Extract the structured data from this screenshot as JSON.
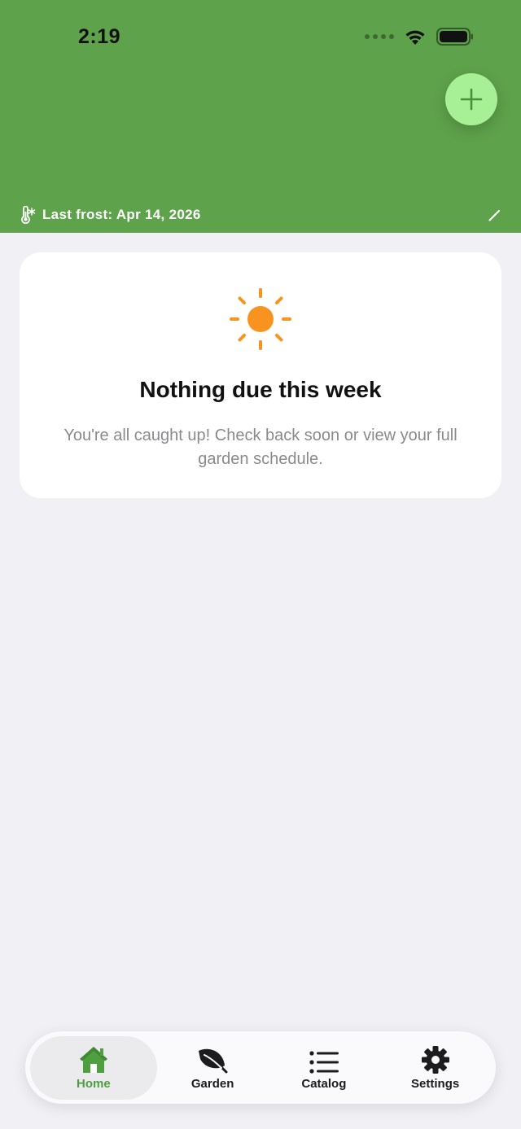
{
  "status_bar": {
    "time": "2:19"
  },
  "header": {
    "background_color": "#5ea24b",
    "add_button_icon": "plus-icon",
    "frost_icon": "thermometer-snowflake-icon",
    "frost_label": "Last frost: Apr 14, 2026",
    "edit_icon": "pencil-icon"
  },
  "empty_state": {
    "icon": "sun-icon",
    "icon_color": "#f7931e",
    "title": "Nothing due this week",
    "message": "You're all caught up! Check back soon or view your full garden schedule."
  },
  "tabbar": {
    "accent_color": "#4f9e3f",
    "tabs": [
      {
        "label": "Home",
        "icon": "house-icon",
        "active": true
      },
      {
        "label": "Garden",
        "icon": "leaf-icon",
        "active": false
      },
      {
        "label": "Catalog",
        "icon": "list-icon",
        "active": false
      },
      {
        "label": "Settings",
        "icon": "gear-icon",
        "active": false
      }
    ]
  }
}
